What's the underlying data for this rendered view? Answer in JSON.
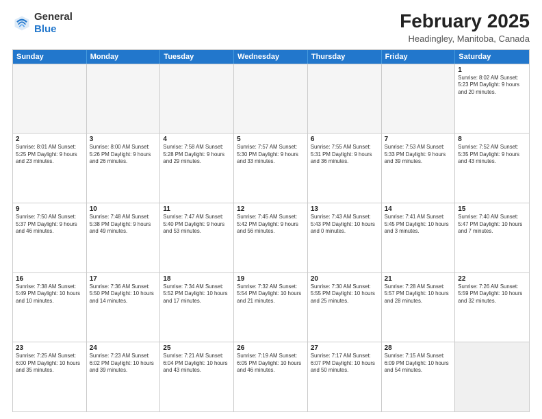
{
  "logo": {
    "line1": "General",
    "line2": "Blue"
  },
  "title": "February 2025",
  "subtitle": "Headingley, Manitoba, Canada",
  "header_days": [
    "Sunday",
    "Monday",
    "Tuesday",
    "Wednesday",
    "Thursday",
    "Friday",
    "Saturday"
  ],
  "rows": [
    [
      {
        "day": "",
        "text": "",
        "empty": true
      },
      {
        "day": "",
        "text": "",
        "empty": true
      },
      {
        "day": "",
        "text": "",
        "empty": true
      },
      {
        "day": "",
        "text": "",
        "empty": true
      },
      {
        "day": "",
        "text": "",
        "empty": true
      },
      {
        "day": "",
        "text": "",
        "empty": true
      },
      {
        "day": "1",
        "text": "Sunrise: 8:02 AM\nSunset: 5:23 PM\nDaylight: 9 hours\nand 20 minutes."
      }
    ],
    [
      {
        "day": "2",
        "text": "Sunrise: 8:01 AM\nSunset: 5:25 PM\nDaylight: 9 hours\nand 23 minutes."
      },
      {
        "day": "3",
        "text": "Sunrise: 8:00 AM\nSunset: 5:26 PM\nDaylight: 9 hours\nand 26 minutes."
      },
      {
        "day": "4",
        "text": "Sunrise: 7:58 AM\nSunset: 5:28 PM\nDaylight: 9 hours\nand 29 minutes."
      },
      {
        "day": "5",
        "text": "Sunrise: 7:57 AM\nSunset: 5:30 PM\nDaylight: 9 hours\nand 33 minutes."
      },
      {
        "day": "6",
        "text": "Sunrise: 7:55 AM\nSunset: 5:31 PM\nDaylight: 9 hours\nand 36 minutes."
      },
      {
        "day": "7",
        "text": "Sunrise: 7:53 AM\nSunset: 5:33 PM\nDaylight: 9 hours\nand 39 minutes."
      },
      {
        "day": "8",
        "text": "Sunrise: 7:52 AM\nSunset: 5:35 PM\nDaylight: 9 hours\nand 43 minutes."
      }
    ],
    [
      {
        "day": "9",
        "text": "Sunrise: 7:50 AM\nSunset: 5:37 PM\nDaylight: 9 hours\nand 46 minutes."
      },
      {
        "day": "10",
        "text": "Sunrise: 7:48 AM\nSunset: 5:38 PM\nDaylight: 9 hours\nand 49 minutes."
      },
      {
        "day": "11",
        "text": "Sunrise: 7:47 AM\nSunset: 5:40 PM\nDaylight: 9 hours\nand 53 minutes."
      },
      {
        "day": "12",
        "text": "Sunrise: 7:45 AM\nSunset: 5:42 PM\nDaylight: 9 hours\nand 56 minutes."
      },
      {
        "day": "13",
        "text": "Sunrise: 7:43 AM\nSunset: 5:43 PM\nDaylight: 10 hours\nand 0 minutes."
      },
      {
        "day": "14",
        "text": "Sunrise: 7:41 AM\nSunset: 5:45 PM\nDaylight: 10 hours\nand 3 minutes."
      },
      {
        "day": "15",
        "text": "Sunrise: 7:40 AM\nSunset: 5:47 PM\nDaylight: 10 hours\nand 7 minutes."
      }
    ],
    [
      {
        "day": "16",
        "text": "Sunrise: 7:38 AM\nSunset: 5:49 PM\nDaylight: 10 hours\nand 10 minutes."
      },
      {
        "day": "17",
        "text": "Sunrise: 7:36 AM\nSunset: 5:50 PM\nDaylight: 10 hours\nand 14 minutes."
      },
      {
        "day": "18",
        "text": "Sunrise: 7:34 AM\nSunset: 5:52 PM\nDaylight: 10 hours\nand 17 minutes."
      },
      {
        "day": "19",
        "text": "Sunrise: 7:32 AM\nSunset: 5:54 PM\nDaylight: 10 hours\nand 21 minutes."
      },
      {
        "day": "20",
        "text": "Sunrise: 7:30 AM\nSunset: 5:55 PM\nDaylight: 10 hours\nand 25 minutes."
      },
      {
        "day": "21",
        "text": "Sunrise: 7:28 AM\nSunset: 5:57 PM\nDaylight: 10 hours\nand 28 minutes."
      },
      {
        "day": "22",
        "text": "Sunrise: 7:26 AM\nSunset: 5:59 PM\nDaylight: 10 hours\nand 32 minutes."
      }
    ],
    [
      {
        "day": "23",
        "text": "Sunrise: 7:25 AM\nSunset: 6:00 PM\nDaylight: 10 hours\nand 35 minutes."
      },
      {
        "day": "24",
        "text": "Sunrise: 7:23 AM\nSunset: 6:02 PM\nDaylight: 10 hours\nand 39 minutes."
      },
      {
        "day": "25",
        "text": "Sunrise: 7:21 AM\nSunset: 6:04 PM\nDaylight: 10 hours\nand 43 minutes."
      },
      {
        "day": "26",
        "text": "Sunrise: 7:19 AM\nSunset: 6:05 PM\nDaylight: 10 hours\nand 46 minutes."
      },
      {
        "day": "27",
        "text": "Sunrise: 7:17 AM\nSunset: 6:07 PM\nDaylight: 10 hours\nand 50 minutes."
      },
      {
        "day": "28",
        "text": "Sunrise: 7:15 AM\nSunset: 6:09 PM\nDaylight: 10 hours\nand 54 minutes."
      },
      {
        "day": "",
        "text": "",
        "empty": true,
        "shaded": true
      }
    ]
  ]
}
